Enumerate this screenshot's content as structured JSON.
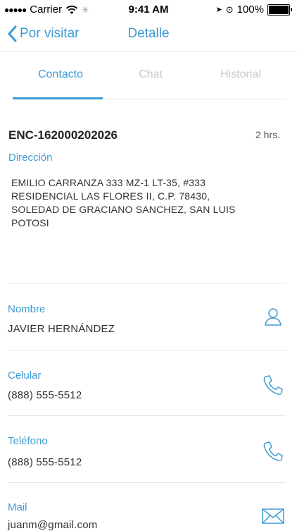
{
  "status_bar": {
    "carrier": "Carrier",
    "time": "9:41 AM",
    "battery": "100%"
  },
  "nav": {
    "back_label": "Por visitar",
    "title": "Detalle"
  },
  "tabs": [
    {
      "label": "Contacto"
    },
    {
      "label": "Chat"
    },
    {
      "label": "Historial"
    }
  ],
  "record": {
    "id": "ENC-162000202026",
    "time_ago": "2 hrs.",
    "address_label": "Dirección",
    "address_lines": [
      "EMILIO CARRANZA 333  MZ-1  LT-35, #333",
      "RESIDENCIAL LAS FLORES II, C.P. 78430,",
      "SOLEDAD DE GRACIANO SANCHEZ, SAN LUIS",
      "POTOSI"
    ]
  },
  "fields": [
    {
      "label": "Nombre",
      "value": "JAVIER HERNÁNDEZ",
      "icon": "person-icon"
    },
    {
      "label": "Celular",
      "value": "(888) 555-5512",
      "icon": "phone-icon"
    },
    {
      "label": "Teléfono",
      "value": "(888) 555-5512",
      "icon": "phone-icon"
    },
    {
      "label": "Mail",
      "value": "juanm@gmail.com",
      "icon": "mail-icon"
    }
  ],
  "colors": {
    "accent": "#3d9bd2",
    "inactive_tab": "#c9c9c9",
    "divider": "#e3e3e3"
  }
}
